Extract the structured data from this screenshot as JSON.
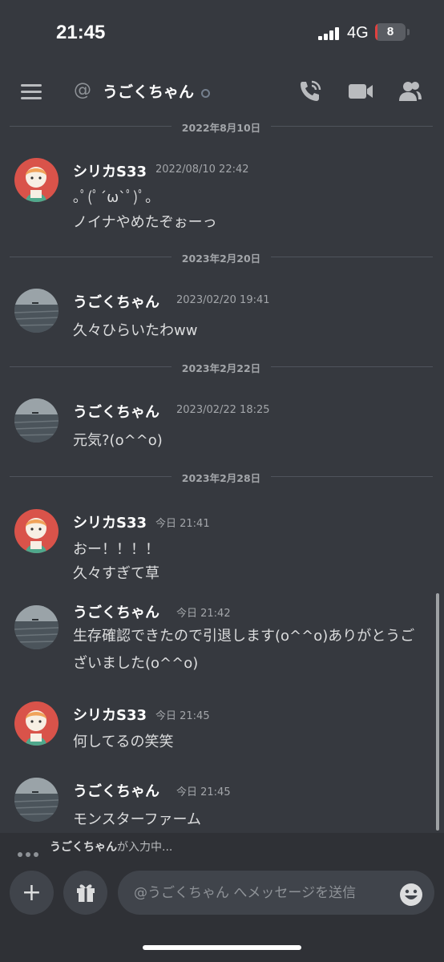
{
  "status_bar": {
    "time": "21:45",
    "network": "4G",
    "battery": "8",
    "battery_level": 0.08
  },
  "header": {
    "at_symbol": "@",
    "channel_name": "うごくちゃん",
    "icons": [
      "menu-icon",
      "phone-call-icon",
      "video-camera-icon",
      "members-icon"
    ]
  },
  "dividers": [
    "2022年8月10日",
    "2023年2月20日",
    "2023年2月22日",
    "2023年2月28日"
  ],
  "messages": [
    {
      "user": "シリカS33",
      "time": "2022/08/10 22:42",
      "lines": [
        "｡ﾟ(ﾟ´ω`ﾟ)ﾟ｡",
        "ノイナやめたぞぉーっ"
      ],
      "avatar": "illustrated-character-avatar"
    },
    {
      "user": "うごくちゃん",
      "time": "2023/02/20 19:41",
      "lines": [
        "久々ひらいたわww"
      ],
      "avatar": "sea-photo-avatar"
    },
    {
      "user": "うごくちゃん",
      "time": "2023/02/22 18:25",
      "lines": [
        "元気?(o^^o)"
      ],
      "avatar": "sea-photo-avatar"
    },
    {
      "user": "シリカS33",
      "time": "今日 21:41",
      "lines": [
        "おー！！！！",
        "久々すぎて草"
      ],
      "avatar": "illustrated-character-avatar"
    },
    {
      "user": "うごくちゃん",
      "time": "今日 21:42",
      "lines": [
        "生存確認できたので引退します(o^^o)ありがとうご",
        "ざいました(o^^o)"
      ],
      "avatar": "sea-photo-avatar"
    },
    {
      "user": "シリカS33",
      "time": "今日 21:45",
      "lines": [
        "何してるの笑笑"
      ],
      "avatar": "illustrated-character-avatar"
    },
    {
      "user": "うごくちゃん",
      "time": "今日 21:45",
      "lines": [
        "モンスターファーム"
      ],
      "avatar": "sea-photo-avatar"
    }
  ],
  "typing": {
    "user": "うごくちゃん",
    "suffix": "が入力中..."
  },
  "composer": {
    "placeholder": "@うごくちゃん へメッセージを送信",
    "plus_label": "+"
  },
  "colors": {
    "background": "#36393f",
    "composer_bg": "#2f3136",
    "input_bg": "#40444b",
    "text": "#dcddde",
    "muted": "#a3a6aa",
    "battery_low": "#e0413f"
  }
}
